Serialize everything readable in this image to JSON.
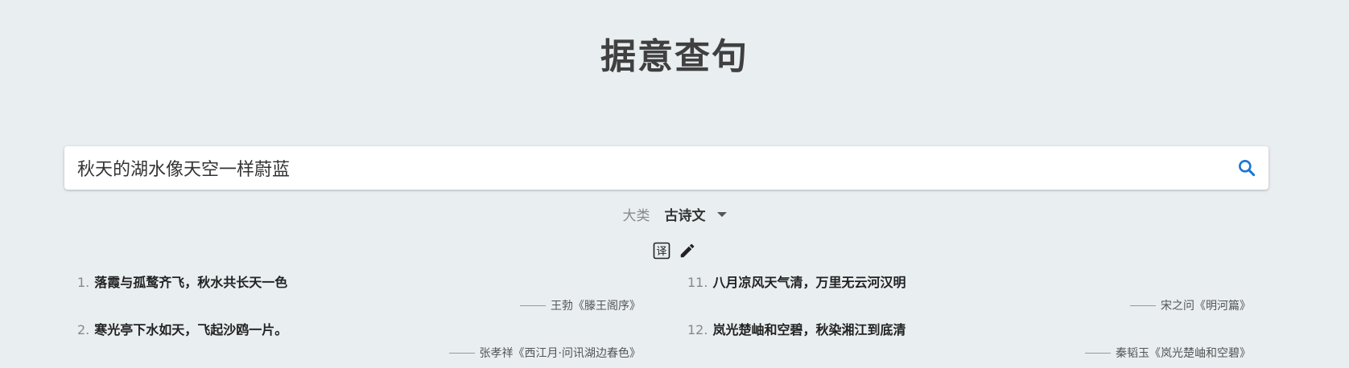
{
  "title": "据意查句",
  "search": {
    "value": "秋天的湖水像天空一样蔚蓝",
    "icon": "search-icon"
  },
  "category": {
    "label": "大类",
    "value": "古诗文"
  },
  "tools": {
    "translate_glyph": "译"
  },
  "colors": {
    "accent": "#1976d2",
    "background": "#e9eef1"
  },
  "results_left": [
    {
      "num": "1.",
      "text": "落霞与孤鹜齐飞，秋水共长天一色",
      "source": "王勃《滕王阁序》"
    },
    {
      "num": "2.",
      "text": "寒光亭下水如天，飞起沙鸥一片。",
      "source": "张孝祥《西江月·问讯湖边春色》"
    }
  ],
  "results_right": [
    {
      "num": "11.",
      "text": "八月凉风天气清，万里无云河汉明",
      "source": "宋之问《明河篇》"
    },
    {
      "num": "12.",
      "text": "岚光楚岫和空碧，秋染湘江到底清",
      "source": "秦韬玉《岚光楚岫和空碧》"
    }
  ]
}
